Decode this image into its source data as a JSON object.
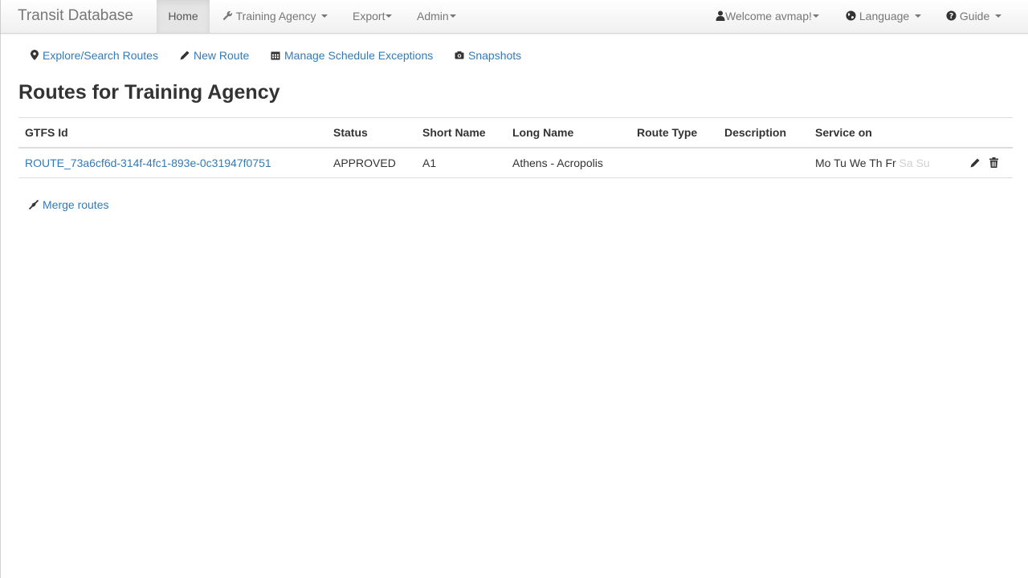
{
  "navbar": {
    "brand": "Transit Database",
    "home": "Home",
    "agency": "Training Agency",
    "export": "Export",
    "admin": "Admin",
    "welcome": "Welcome avmap!",
    "language": "Language",
    "guide": "Guide"
  },
  "subnav": {
    "explore": "Explore/Search Routes",
    "new_route": "New Route",
    "exceptions": "Manage Schedule Exceptions",
    "snapshots": "Snapshots"
  },
  "page": {
    "title": "Routes for Training Agency"
  },
  "table": {
    "headers": {
      "gtfs_id": "GTFS Id",
      "status": "Status",
      "short_name": "Short Name",
      "long_name": "Long Name",
      "route_type": "Route Type",
      "description": "Description",
      "service_on": "Service on"
    },
    "rows": [
      {
        "gtfs_id": "ROUTE_73a6cf6d-314f-4fc1-893e-0c31947f0751",
        "status": "APPROVED",
        "short_name": "A1",
        "long_name": "Athens - Acropolis",
        "route_type": "",
        "description": "",
        "days": [
          {
            "label": "Mo",
            "active": true
          },
          {
            "label": "Tu",
            "active": true
          },
          {
            "label": "We",
            "active": true
          },
          {
            "label": "Th",
            "active": true
          },
          {
            "label": "Fr",
            "active": true
          },
          {
            "label": "Sa",
            "active": false
          },
          {
            "label": "Su",
            "active": false
          }
        ]
      }
    ]
  },
  "merge": {
    "label": "Merge routes"
  },
  "colors": {
    "link": "#337ab7",
    "text": "#333333",
    "muted": "#777777",
    "inactive_day": "#d0d0d0"
  }
}
